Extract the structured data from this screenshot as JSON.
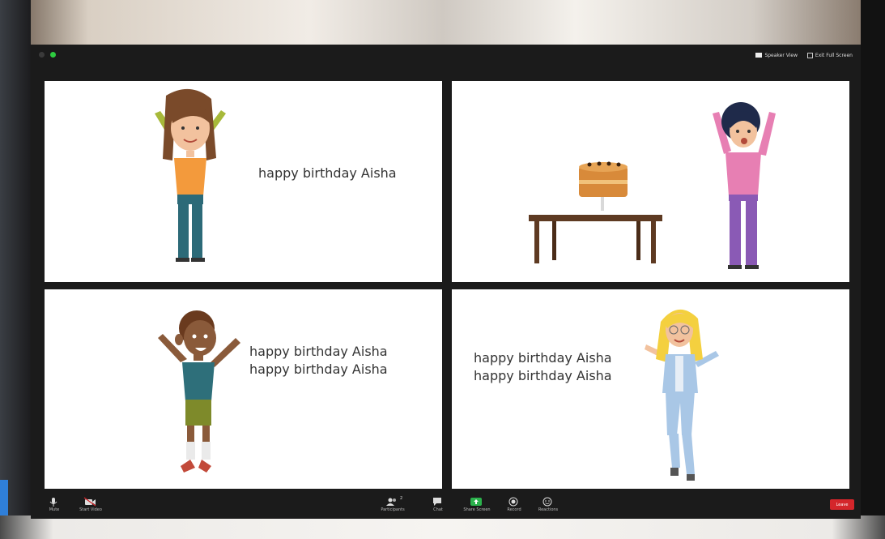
{
  "window": {
    "speaker_view_label": "Speaker View",
    "exit_full_screen_label": "Exit Full Screen"
  },
  "tiles": [
    {
      "lines": [
        "happy birthday Aisha"
      ]
    },
    {
      "lines": []
    },
    {
      "lines": [
        "happy birthday Aisha",
        "happy birthday Aisha"
      ]
    },
    {
      "lines": [
        "happy birthday Aisha",
        "happy birthday Aisha"
      ]
    }
  ],
  "toolbar": {
    "mute_label": "Mute",
    "video_label": "Start Video",
    "participants_label": "Participants",
    "participants_count": "2",
    "chat_label": "Chat",
    "share_label": "Share Screen",
    "record_label": "Record",
    "reactions_label": "Reactions",
    "leave_label": "Leave"
  },
  "colors": {
    "share_green": "#2bb24c",
    "leave_red": "#d4262b"
  }
}
